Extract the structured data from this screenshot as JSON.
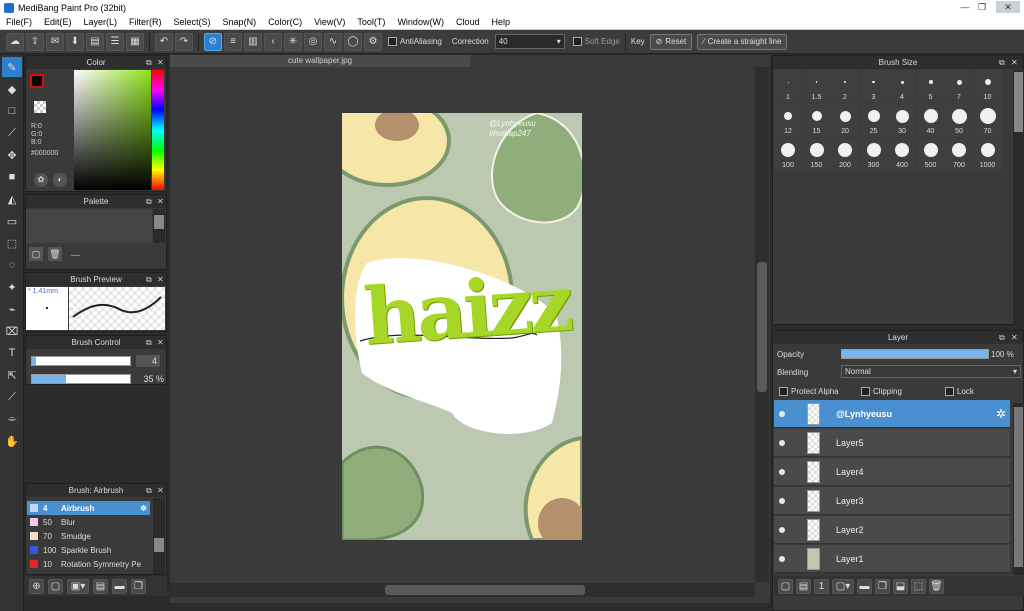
{
  "titlebar": {
    "title": "MediBang Paint Pro (32bit)",
    "min": "—",
    "max": "❐",
    "close": "✕"
  },
  "menu": [
    "File(F)",
    "Edit(E)",
    "Layer(L)",
    "Filter(R)",
    "Select(S)",
    "Snap(N)",
    "Color(C)",
    "View(V)",
    "Tool(T)",
    "Window(W)",
    "Cloud",
    "Help"
  ],
  "toolbar": {
    "antialiasing": "AntiAliasing",
    "correction_label": "Correction",
    "correction_value": "40",
    "soft_edge": "Soft Edge",
    "key": "Key",
    "reset": "Reset",
    "straight_line": "Create a straight line"
  },
  "color_panel": {
    "title": "Color",
    "r": "R:0",
    "g": "G:0",
    "b": "B:0",
    "hex": "#000000"
  },
  "palette": {
    "title": "Palette",
    "dash": "---"
  },
  "brush_preview": {
    "title": "Brush Preview",
    "size": "1.41mm"
  },
  "brush_control": {
    "title": "Brush Control",
    "size_value": "4",
    "opacity_value": "35 %"
  },
  "brush_list": {
    "title": "Brush: Airbrush",
    "items": [
      {
        "num": "4",
        "name": "Airbrush",
        "color": "#c9d6f0"
      },
      {
        "num": "50",
        "name": "Blur",
        "color": "#f3c7ee"
      },
      {
        "num": "70",
        "name": "Smudge",
        "color": "#f6dec0"
      },
      {
        "num": "100",
        "name": "Sparkle Brush",
        "color": "#3059e0"
      },
      {
        "num": "10",
        "name": "Rotation Symmetry Pe",
        "color": "#e02a2a"
      }
    ]
  },
  "canvas": {
    "tab": "cute wallpaper.jpg",
    "art_line1": "@Lynhyeusu",
    "art_line2": "#hoidap247",
    "art_big": "haizz"
  },
  "brush_size": {
    "title": "Brush Size",
    "sizes": [
      "1",
      "1.5",
      "2",
      "3",
      "4",
      "5",
      "7",
      "10",
      "12",
      "15",
      "20",
      "25",
      "30",
      "40",
      "50",
      "70",
      "100",
      "150",
      "200",
      "300",
      "400",
      "500",
      "700",
      "1000"
    ]
  },
  "layer_panel": {
    "title": "Layer",
    "opacity_label": "Opacity",
    "opacity_value": "100 %",
    "opacity_level": 1.0,
    "blending_label": "Blending",
    "blending_value": "Normal",
    "protect_alpha": "Protect Alpha",
    "clipping": "Clipping",
    "lock": "Lock",
    "layers": [
      "@Lynhyeusu",
      "Layer5",
      "Layer4",
      "Layer3",
      "Layer2",
      "Layer1"
    ]
  }
}
